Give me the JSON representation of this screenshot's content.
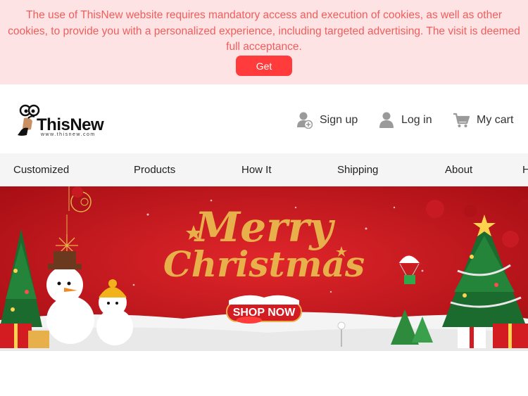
{
  "cookie_banner": {
    "message": "The use of ThisNew website requires mandatory access and execution of cookies, as well as other cookies, to provide you with a personalized experience, including targeted advertising. The visit is deemed full acceptance.",
    "button_label": "Get"
  },
  "header": {
    "logo_text": "ThisNew",
    "logo_url_text": "www.thisnew.com",
    "signup_label": "Sign up",
    "login_label": "Log in",
    "cart_label": "My cart"
  },
  "nav": {
    "items": [
      {
        "label": "Customized"
      },
      {
        "label": "Products"
      },
      {
        "label": "How It"
      },
      {
        "label": "Shipping"
      },
      {
        "label": "About"
      },
      {
        "label": "H"
      }
    ]
  },
  "hero": {
    "headline_line1": "Merry",
    "headline_line2": "Christmas",
    "cta_label": "SHOP NOW"
  },
  "colors": {
    "cookie_bg": "#fde3e3",
    "cookie_text": "#f15d5d",
    "accent_red": "#ff3b3b",
    "hero_red": "#c8161d",
    "gold": "#e8b04a"
  }
}
